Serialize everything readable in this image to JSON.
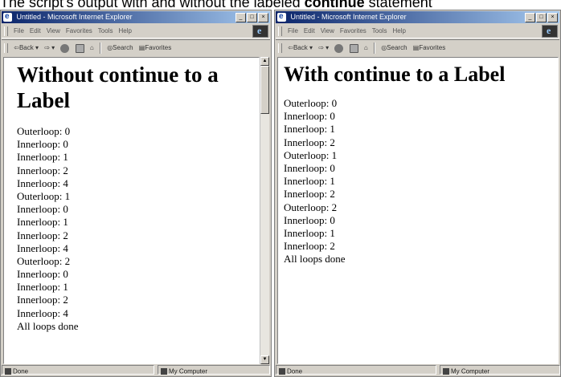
{
  "caption": {
    "prefix": "The script's output with and without the labeled ",
    "keyword": "continue",
    "suffix": " statement"
  },
  "windows": [
    {
      "title": "Untitled - Microsoft Internet Explorer",
      "menu": [
        "File",
        "Edit",
        "View",
        "Favorites",
        "Tools",
        "Help"
      ],
      "toolbar": {
        "back": "Back",
        "search": "Search",
        "favorites": "Favorites"
      },
      "heading": "Without continue to a Label",
      "lines": [
        "Outerloop: 0",
        "Innerloop: 0",
        "Innerloop: 1",
        "Innerloop: 2",
        "Innerloop: 4",
        "Outerloop: 1",
        "Innerloop: 0",
        "Innerloop: 1",
        "Innerloop: 2",
        "Innerloop: 4",
        "Outerloop: 2",
        "Innerloop: 0",
        "Innerloop: 1",
        "Innerloop: 2",
        "Innerloop: 4",
        "All loops done"
      ],
      "status": {
        "left": "Done",
        "zone": "My Computer"
      }
    },
    {
      "title": "Untitled - Microsoft Internet Explorer",
      "menu": [
        "File",
        "Edit",
        "View",
        "Favorites",
        "Tools",
        "Help"
      ],
      "toolbar": {
        "back": "Back",
        "search": "Search",
        "favorites": "Favorites"
      },
      "heading": "With continue to a Label",
      "lines": [
        "Outerloop: 0",
        "Innerloop: 0",
        "Innerloop: 1",
        "Innerloop: 2",
        "Outerloop: 1",
        "Innerloop: 0",
        "Innerloop: 1",
        "Innerloop: 2",
        "Outerloop: 2",
        "Innerloop: 0",
        "Innerloop: 1",
        "Innerloop: 2",
        "All loops done"
      ],
      "status": {
        "left": "Done",
        "zone": "My Computer"
      }
    }
  ],
  "icons": {
    "app": "ie-logo-icon",
    "minimize": "minimize-icon",
    "maximize": "maximize-icon",
    "close": "close-icon",
    "forward": "forward-arrow-icon",
    "stop": "stop-icon",
    "refresh": "refresh-icon",
    "home": "home-icon",
    "search": "search-icon",
    "favorites": "favorites-icon",
    "status": "page-done-icon",
    "zone": "my-computer-icon"
  }
}
